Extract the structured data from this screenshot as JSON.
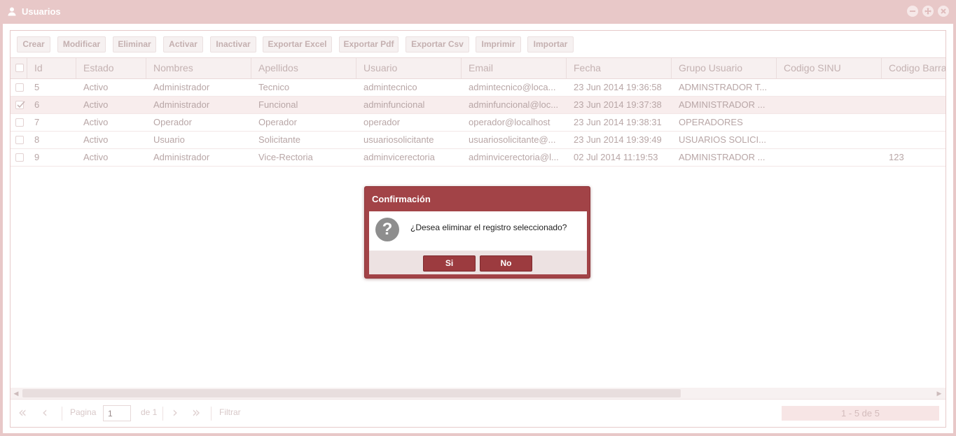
{
  "window": {
    "title": "Usuarios",
    "colors": {
      "frame": "#e8c8c8",
      "accent": "#a24347"
    }
  },
  "toolbar": {
    "buttons": [
      "Crear",
      "Modificar",
      "Eliminar",
      "Activar",
      "Inactivar",
      "Exportar Excel",
      "Exportar Pdf",
      "Exportar Csv",
      "Imprimir",
      "Importar"
    ]
  },
  "grid": {
    "columns": [
      "Id",
      "Estado",
      "Nombres",
      "Apellidos",
      "Usuario",
      "Email",
      "Fecha",
      "Grupo Usuario",
      "Codigo SINU",
      "Codigo Barra"
    ],
    "rows": [
      {
        "checked": false,
        "selected": false,
        "cells": [
          "5",
          "Activo",
          "Administrador",
          "Tecnico",
          "admintecnico",
          "admintecnico@loca...",
          "23 Jun 2014 19:36:58",
          "ADMINSTRADOR T...",
          "",
          ""
        ]
      },
      {
        "checked": true,
        "selected": true,
        "cells": [
          "6",
          "Activo",
          "Administrador",
          "Funcional",
          "adminfuncional",
          "adminfuncional@loc...",
          "23 Jun 2014 19:37:38",
          "ADMINISTRADOR ...",
          "",
          ""
        ]
      },
      {
        "checked": false,
        "selected": false,
        "cells": [
          "7",
          "Activo",
          "Operador",
          "Operador",
          "operador",
          "operador@localhost",
          "23 Jun 2014 19:38:31",
          "OPERADORES",
          "",
          ""
        ]
      },
      {
        "checked": false,
        "selected": false,
        "cells": [
          "8",
          "Activo",
          "Usuario",
          "Solicitante",
          "usuariosolicitante",
          "usuariosolicitante@...",
          "23 Jun 2014 19:39:49",
          "USUARIOS SOLICI...",
          "",
          ""
        ]
      },
      {
        "checked": false,
        "selected": false,
        "cells": [
          "9",
          "Activo",
          "Administrador",
          "Vice-Rectoria",
          "adminvicerectoria",
          "adminvicerectoria@l...",
          "02 Jul 2014 11:19:53",
          "ADMINISTRADOR ...",
          "",
          "123"
        ]
      }
    ]
  },
  "pager": {
    "page_label": "Pagina",
    "page_value": "1",
    "of_label": "de 1",
    "filter_label": "Filtrar",
    "count_text": "1 - 5 de 5"
  },
  "dialog": {
    "title": "Confirmación",
    "message": "¿Desea eliminar el registro seleccionado?",
    "icon": "question-icon",
    "yes_label": "Si",
    "no_label": "No"
  }
}
